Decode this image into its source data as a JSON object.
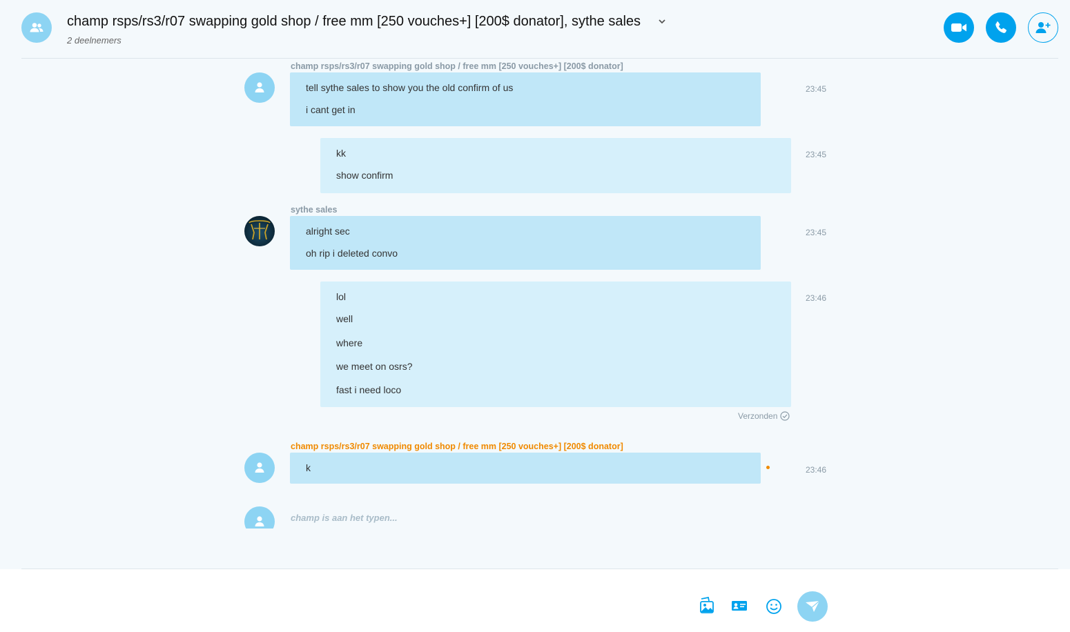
{
  "header": {
    "title": "champ rsps/rs3/r07 swapping gold shop / free mm [250 vouches+] [200$ donator], sythe sales",
    "participants": "2 deelnemers",
    "buttons": {
      "video": "video-call",
      "audio": "audio-call",
      "add": "add-participant"
    }
  },
  "messages": [
    {
      "sender": "champ rsps/rs3/r07 swapping gold shop / free mm [250 vouches+] [200$ donator]",
      "avatar": "default",
      "lines": [
        "tell sythe sales to show you the old confirm of us",
        "i cant get in"
      ],
      "time": "23:45"
    },
    {
      "sender": "",
      "mine": true,
      "lines": [
        "kk",
        "show confirm"
      ],
      "time": "23:45"
    },
    {
      "sender": "sythe sales",
      "avatar": "photo",
      "lines": [
        "alright sec",
        "oh rip i deleted convo"
      ],
      "time": "23:45"
    },
    {
      "sender": "",
      "mine": true,
      "lines": [
        "lol",
        "well",
        "where",
        "we meet on osrs?",
        "fast i need loco"
      ],
      "time": "23:46",
      "status": "Verzonden"
    },
    {
      "sender": "champ rsps/rs3/r07 swapping gold shop / free mm [250 vouches+] [200$ donator]",
      "avatar": "default",
      "unread": true,
      "lines": [
        "k"
      ],
      "time": "23:46"
    }
  ],
  "typing": "champ is aan het typen...",
  "composer": {
    "icons": [
      "image-icon",
      "contact-card-icon",
      "emoji-icon",
      "send-icon"
    ]
  },
  "colors": {
    "accent": "#00a2ed",
    "avatar_bg": "#8dd4f3",
    "bubble_incoming": "#c0e7f8",
    "bubble_outgoing": "#d6f0fb",
    "unread": "#f08a00",
    "background": "#f4f9fc"
  }
}
